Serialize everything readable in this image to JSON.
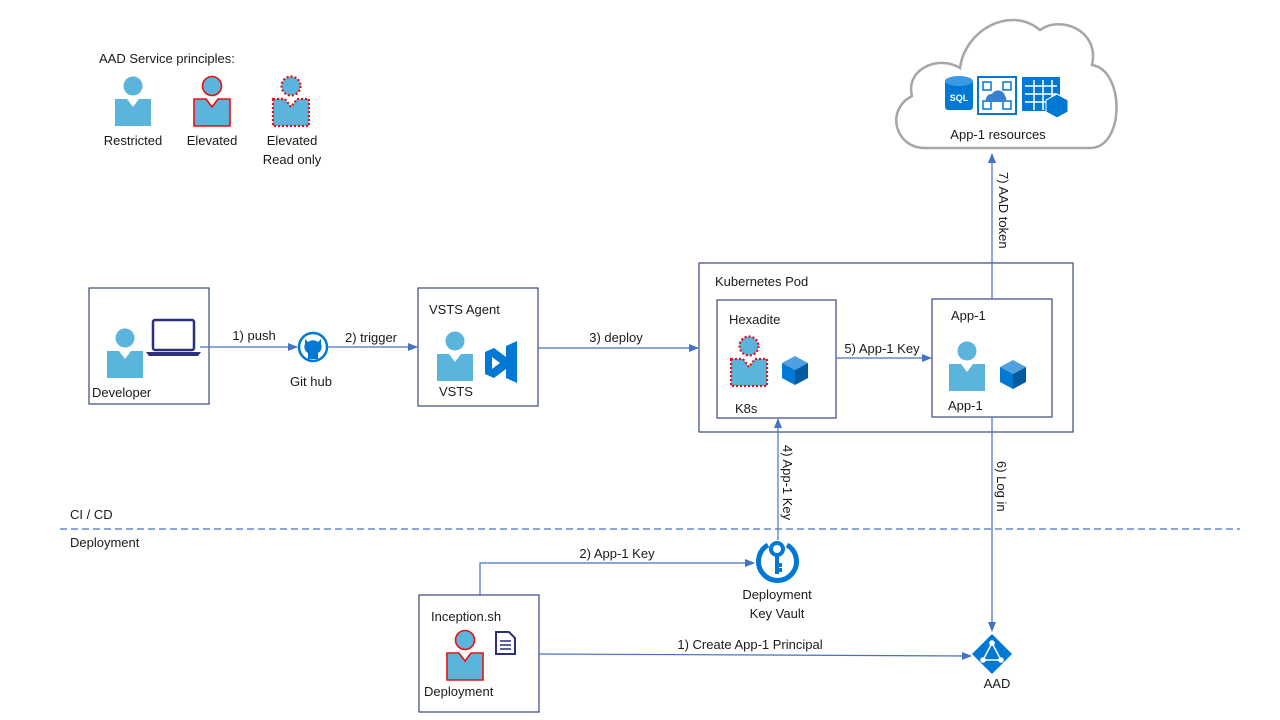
{
  "colors": {
    "person": "#5ab4dc",
    "elevated_outline": "#e81010",
    "arrow": "#4472c4",
    "box_border": "#3a4a7c",
    "azure_icon": "#0078d4",
    "cloud_outline": "#a6a6a6"
  },
  "legend": {
    "title": "AAD Service principles:",
    "items": [
      {
        "label": "Restricted",
        "icon": "person-restricted-icon"
      },
      {
        "label": "Elevated",
        "icon": "person-elevated-icon"
      },
      {
        "label_line1": "Elevated",
        "label_line2": "Read only",
        "icon": "person-elevated-readonly-icon"
      }
    ]
  },
  "cloud": {
    "label": "App-1 resources",
    "icons": [
      "sql-database-icon",
      "app-service-icon",
      "table-storage-icon"
    ]
  },
  "nodes": {
    "developer": {
      "label": "Developer"
    },
    "github": {
      "label": "Git hub"
    },
    "vsts_agent": {
      "title": "VSTS Agent",
      "label": "VSTS"
    },
    "k8s_pod": {
      "title": "Kubernetes Pod"
    },
    "hexadite": {
      "title": "Hexadite",
      "label": "K8s"
    },
    "app1": {
      "title": "App-1",
      "label": "App-1"
    },
    "key_vault": {
      "line1": "Deployment",
      "line2": "Key Vault"
    },
    "inception": {
      "title": "Inception.sh",
      "label": "Deployment"
    },
    "aad": {
      "label": "AAD"
    }
  },
  "edges": {
    "push": "1) push",
    "trigger": "2) trigger",
    "deploy": "3) deploy",
    "app1_key_pod": "5) App-1 Key",
    "aad_token": "7) AAD token",
    "log_in": "6) Log in",
    "app1_key_vault_to_hexadite": "4) App-1 Key",
    "app1_key_to_vault": "2) App-1 Key",
    "create_principal": "1) Create App-1 Principal"
  },
  "zones": {
    "top": "CI / CD",
    "bottom": "Deployment"
  }
}
